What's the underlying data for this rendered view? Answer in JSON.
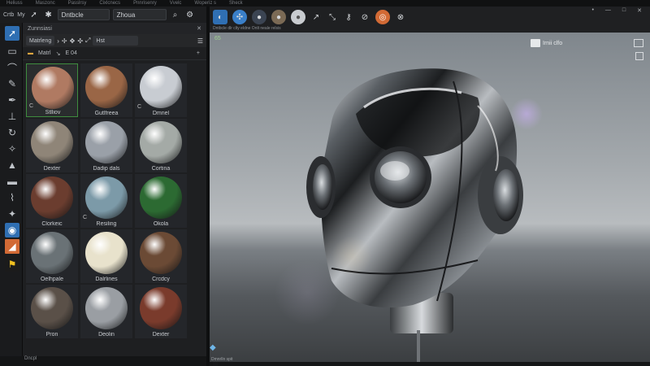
{
  "menubar": {
    "items": [
      "Heliuss",
      "Maszonc",
      "Passlrsy",
      "Cixlcnecs",
      "Pnnrisenry",
      "Vvelc",
      "Woperiz s",
      "Sheck"
    ]
  },
  "toprow": {
    "btn1": "Crtb",
    "btn2": "My",
    "field1": "Dntbcle",
    "field2": "Zhoua"
  },
  "panel": {
    "title": "Zunnsiasi",
    "row2": {
      "chip1": "Matrleng",
      "chip2": "Hst"
    },
    "row3": {
      "label1": "Matrl",
      "label2": "E 04"
    },
    "footer": "Dcpcol"
  },
  "materials": [
    {
      "name": "Stlliov",
      "tag": "C",
      "color": "#b07a62",
      "selected": true
    },
    {
      "name": "Gutlfreea",
      "tag": "",
      "color": "#9a6646",
      "selected": false
    },
    {
      "name": "Dmnel",
      "tag": "C",
      "color": "#c8ccd2",
      "selected": false
    },
    {
      "name": "Dexter",
      "tag": "",
      "color": "#8f8578",
      "selected": false
    },
    {
      "name": "Dadip dals",
      "tag": "",
      "color": "#9aa0a8",
      "selected": false
    },
    {
      "name": "Cortina",
      "tag": "",
      "color": "#a4aaa6",
      "selected": false
    },
    {
      "name": "Clorkeic",
      "tag": "",
      "color": "#6b3d2f",
      "selected": false
    },
    {
      "name": "Resiling",
      "tag": "C",
      "color": "#7c9aa8",
      "selected": false
    },
    {
      "name": "Okola",
      "tag": "",
      "color": "#2c6a32",
      "selected": false
    },
    {
      "name": "Oelhpale",
      "tag": "",
      "color": "#6a7276",
      "selected": false
    },
    {
      "name": "Dalrlines",
      "tag": "",
      "color": "#e8e2cc",
      "selected": false
    },
    {
      "name": "Crcdcy",
      "tag": "",
      "color": "#6b4a35",
      "selected": false
    },
    {
      "name": "Pron",
      "tag": "",
      "color": "#5a5048",
      "selected": false
    },
    {
      "name": "Deolin",
      "tag": "",
      "color": "#9a9ea3",
      "selected": false
    },
    {
      "name": "Dexter",
      "tag": "",
      "color": "#7a3b2c",
      "selected": false
    }
  ],
  "viewport": {
    "toolbar_caption": "Dntbcle dlr clty eldne Onlt neale relsis",
    "label": "Irnii clfo",
    "corner": "65",
    "footer": "Dmnrlln spit"
  },
  "status": {
    "text": "Dncpl"
  },
  "window": {
    "ctrl1": "•",
    "ctrl2": "—",
    "ctrl3": "□",
    "ctrl4": "✕"
  },
  "colors": {
    "accent_blue": "#2f6fb3",
    "selected_green": "#3f8c3f",
    "orange": "#d26a35"
  }
}
